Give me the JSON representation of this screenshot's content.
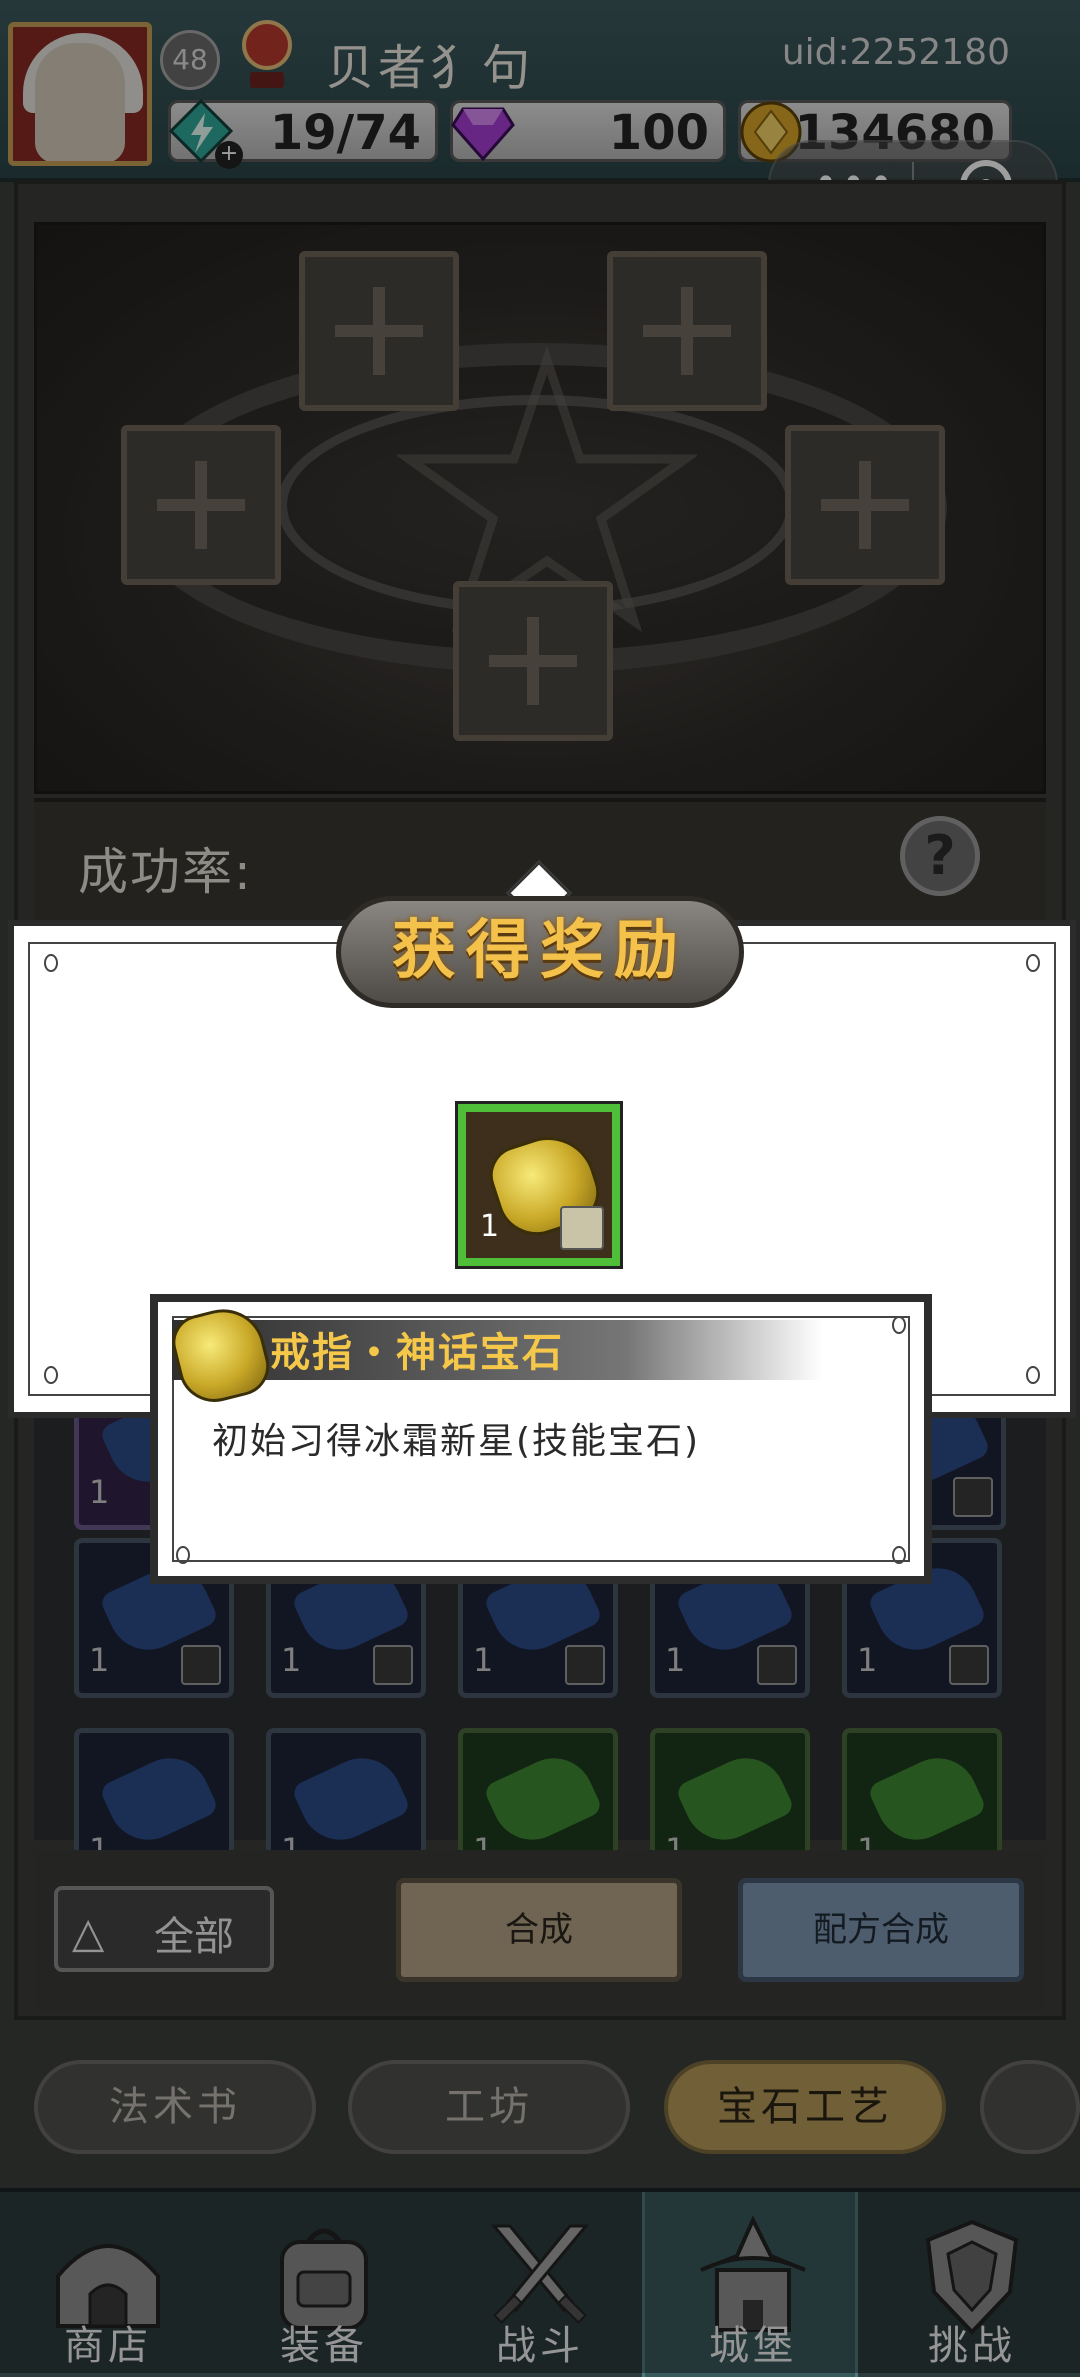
{
  "player": {
    "level": "48",
    "name": "贝者犭句",
    "uid": "uid:2252180"
  },
  "resources": {
    "energy": "19/74",
    "diamonds": "100",
    "gold": "134680",
    "energy_plus": "+"
  },
  "capsule": {
    "dots": "•••"
  },
  "forge": {
    "success_label": "成功率:",
    "help_label": "?"
  },
  "controls": {
    "filter_label": "全部",
    "filter_icon": "△",
    "synthesize_label": "合成",
    "recipe_label": "配方合成"
  },
  "inventory": {
    "counts": [
      "1",
      "1",
      "1",
      "1",
      "1",
      "1",
      "1",
      "1",
      "1",
      "1",
      "1",
      "1"
    ]
  },
  "tabs": [
    {
      "label": "法术书"
    },
    {
      "label": "工坊"
    },
    {
      "label": "宝石工艺"
    }
  ],
  "nav": [
    {
      "label": "商店"
    },
    {
      "label": "装备"
    },
    {
      "label": "战斗"
    },
    {
      "label": "城堡"
    },
    {
      "label": "挑战"
    }
  ],
  "reward": {
    "title": "获得奖励",
    "item_count": "1"
  },
  "tooltip": {
    "name": "戒指・神话宝石",
    "description": "初始习得冰霜新星(技能宝石)"
  },
  "colors": {
    "accent_gold": "#f5c84a",
    "rarity_green": "#4fbf3a",
    "active_tab": "#b59a5a"
  }
}
